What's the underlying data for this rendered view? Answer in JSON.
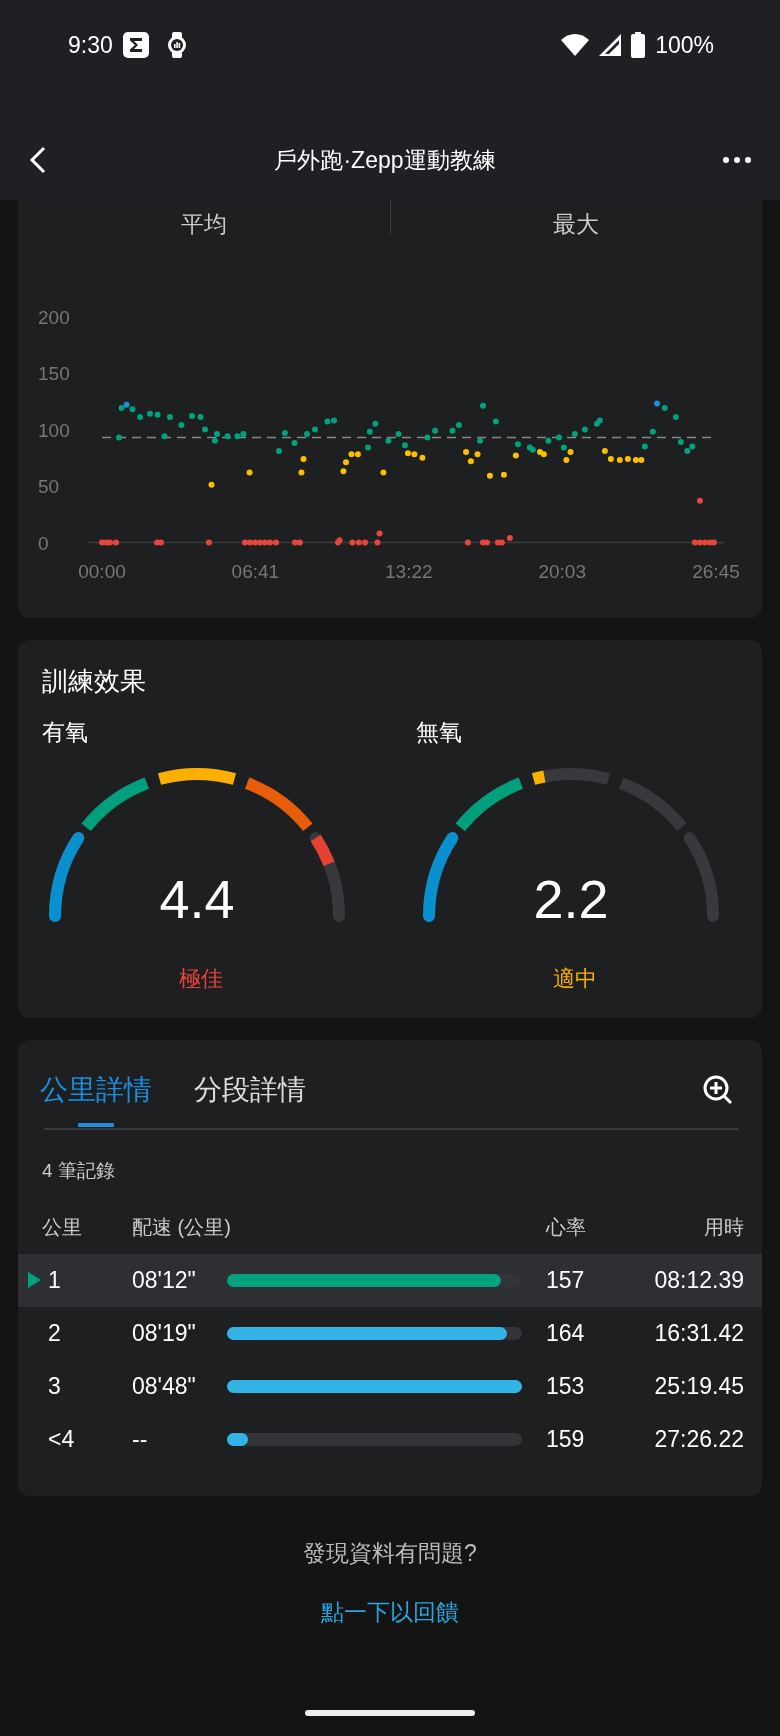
{
  "status_bar": {
    "time": "9:30",
    "battery": "100%"
  },
  "app_bar": {
    "title": "戶外跑·Zepp運動教練"
  },
  "stats_tabs": [
    "平均",
    "最大"
  ],
  "chart": {
    "chart_data": {
      "type": "scatter",
      "xticks": [
        {
          "value": 0,
          "label": "00:00"
        },
        {
          "value": 6.683,
          "label": "06:41"
        },
        {
          "value": 13.367,
          "label": "13:22"
        },
        {
          "value": 20.05,
          "label": "20:03"
        },
        {
          "value": 26.75,
          "label": "26:45"
        }
      ],
      "yticks": [
        0,
        50,
        100,
        150,
        200
      ],
      "xlim": [
        0,
        26.75
      ],
      "ylim": [
        0,
        200
      ],
      "ref_lines": [
        {
          "axis": "y",
          "value": 93
        }
      ],
      "series": [
        {
          "color": "#00a37d",
          "x": [
            0.74,
            0.85,
            1.33,
            1.66,
            2.09,
            2.42,
            2.72,
            2.96,
            3.46,
            3.92,
            4.29,
            4.49,
            4.92,
            5.01,
            5.47,
            5.9,
            6.16,
            7.71,
            7.97,
            8.39,
            8.93,
            9.28,
            9.82,
            10.11,
            11.59,
            11.67,
            11.91,
            12.48,
            12.92,
            13.2,
            14.18,
            14.51,
            15.27,
            15.55,
            16.6,
            16.47,
            17.16,
            18.12,
            18.64,
            18.77,
            19.45,
            19.91,
            20.12,
            20.6,
            21.04,
            21.56,
            21.69,
            23.65,
            24.0,
            24.52,
            25.0,
            25.22,
            25.5,
            25.72
          ],
          "values": [
            93,
            119,
            118,
            111,
            114,
            113,
            94,
            111,
            104,
            112,
            111,
            100,
            90,
            96,
            94,
            94,
            96,
            81,
            97,
            88,
            96,
            100,
            107,
            108,
            84,
            98,
            105,
            90,
            96,
            86,
            93,
            99,
            99,
            104,
            121,
            90,
            107,
            87,
            84,
            82,
            90,
            93,
            84,
            96,
            100,
            105,
            108,
            85,
            98,
            119,
            111,
            89,
            81,
            85
          ]
        },
        {
          "color": "#fbc100",
          "x": [
            4.77,
            6.43,
            8.69,
            8.78,
            10.52,
            10.63,
            10.87,
            11.15,
            12.26,
            13.33,
            13.61,
            13.96,
            15.86,
            16.07,
            16.36,
            16.9,
            17.51,
            18.03,
            19.08,
            19.25,
            20.23,
            20.41,
            21.91,
            22.17,
            22.56,
            22.91,
            23.26,
            23.5
          ],
          "values": [
            51,
            62,
            62,
            74,
            63,
            71,
            78,
            78,
            62,
            79,
            78,
            75,
            80,
            72,
            78,
            59,
            60,
            77,
            80,
            78,
            73,
            80,
            81,
            74,
            73,
            74,
            73,
            73
          ]
        },
        {
          "color": "#e8453c",
          "x": [
            0,
            0.2,
            0.35,
            0.61,
            2.4,
            2.57,
            4.66,
            6.23,
            6.45,
            6.67,
            6.88,
            7.1,
            7.32,
            7.58,
            8.41,
            8.62,
            10.28,
            10.35,
            10.91,
            11.19,
            11.46,
            12.0,
            12.09,
            15.94,
            16.6,
            16.77,
            17.25,
            17.42,
            17.77,
            25.83,
            26.05,
            26.05,
            26.27,
            26.49,
            26.66
          ],
          "values": [
            0,
            0,
            0,
            0,
            0,
            0,
            0,
            0,
            0,
            0,
            0,
            0,
            0,
            0,
            0,
            0,
            0,
            2,
            0,
            0,
            0,
            0,
            8,
            0,
            0,
            0,
            0,
            0,
            4,
            0,
            0,
            37,
            0,
            0,
            0
          ]
        },
        {
          "color": "#1a8fe0",
          "x": [
            1.07,
            24.18
          ],
          "values": [
            122,
            123
          ]
        }
      ]
    }
  },
  "training_effect": {
    "title": "訓練效果",
    "gauges": [
      {
        "title": "有氧",
        "value": "4.4",
        "rating": "極佳",
        "color": "#e8453c"
      },
      {
        "title": "無氧",
        "value": "2.2",
        "rating": "適中",
        "color": "#fbb000"
      }
    ]
  },
  "splits": {
    "tabs": [
      {
        "label": "公里詳情",
        "selected": true
      },
      {
        "label": "分段詳情",
        "selected": false
      }
    ],
    "record_count": "4 筆記錄",
    "columns": [
      "公里",
      "配速 (公里)",
      "心率",
      "用時"
    ],
    "rows": [
      {
        "km": "1",
        "pace": "08'12\"",
        "level": 0.93,
        "heart_rate": "157",
        "time": "08:12.39",
        "selected": true
      },
      {
        "km": "2",
        "pace": "08'19\"",
        "level": 0.95,
        "heart_rate": "164",
        "time": "16:31.42",
        "selected": false
      },
      {
        "km": "3",
        "pace": "08'48\"",
        "level": 1.0,
        "heart_rate": "153",
        "time": "25:19.45",
        "selected": false
      },
      {
        "km": "<4",
        "pace": "--",
        "level": 0.07,
        "heart_rate": "159",
        "time": "27:26.22",
        "selected": false
      }
    ]
  },
  "footer": {
    "question": "發現資料有問題?",
    "link": "點一下以回饋"
  }
}
